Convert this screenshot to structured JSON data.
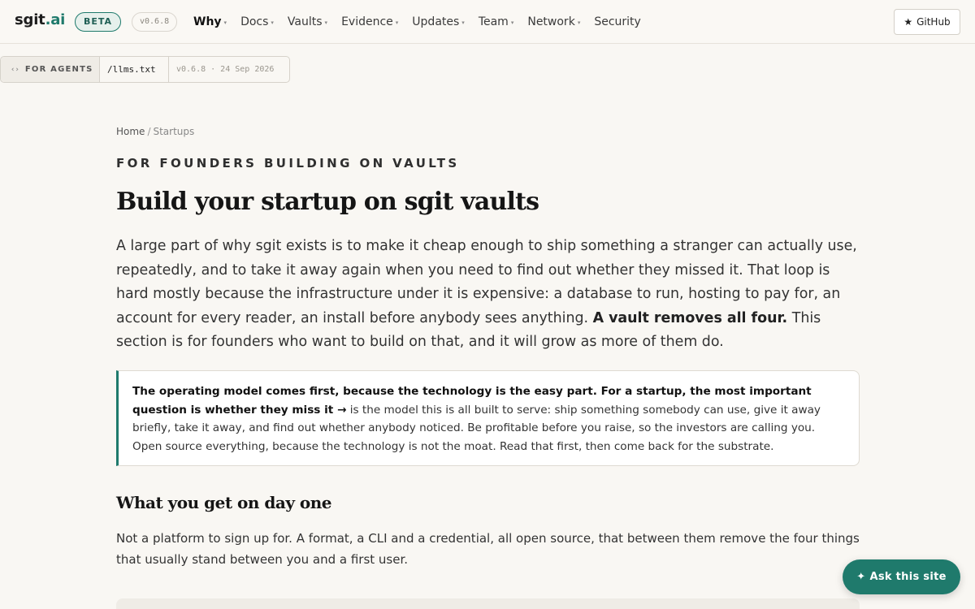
{
  "header": {
    "logo_main": "sgit",
    "logo_accent": ".ai",
    "beta_badge": "BETA",
    "version": "v0.6.8",
    "nav": [
      {
        "label": "Why",
        "caret": "▾"
      },
      {
        "label": "Docs",
        "caret": "▾"
      },
      {
        "label": "Vaults",
        "caret": "▾"
      },
      {
        "label": "Evidence",
        "caret": "▾"
      },
      {
        "label": "Updates",
        "caret": "▾"
      },
      {
        "label": "Team",
        "caret": "▾"
      },
      {
        "label": "Network",
        "caret": "▾"
      },
      {
        "label": "Security",
        "caret": ""
      }
    ],
    "active_nav": "Why",
    "github_icon": "★",
    "github_label": "GitHub"
  },
  "agents": {
    "icon": "‹›",
    "label": "FOR AGENTS",
    "file": "/llms.txt",
    "meta": "v0.6.8 · 24 Sep 2026"
  },
  "breadcrumb": {
    "home": "Home",
    "sep": "/",
    "current": "Startups"
  },
  "eyebrow": "FOR FOUNDERS BUILDING ON VAULTS",
  "title": "Build your startup on sgit vaults",
  "lead": {
    "text_before": "A large part of why sgit exists is to make it cheap enough to ship something a stranger can actually use, repeatedly, and to take it away again when you need to find out whether they missed it. That loop is hard mostly because the infrastructure under it is expensive: a database to run, hosting to pay for, an account for every reader, an install before anybody sees anything. ",
    "bold": "A vault removes all four.",
    "text_after": " This section is for founders who want to build on that, and it will grow as more of them do."
  },
  "callout": {
    "bold": "The operating model comes first, because the technology is the easy part. For a startup, the most important question is whether they miss it →",
    "text": " is the model this is all built to serve: ship something somebody can use, give it away briefly, take it away, and find out whether anybody noticed. Be profitable before you raise, so the investors are calling you. Open source everything, because the technology is not the moat. Read that first, then come back for the substrate."
  },
  "section": {
    "heading": "What you get on day one",
    "paragraph": "Not a platform to sign up for. A format, a CLI and a credential, all open source, that between them remove the four things that usually stand between you and a first user."
  },
  "ask": {
    "icon": "✦",
    "label": "Ask this site"
  }
}
